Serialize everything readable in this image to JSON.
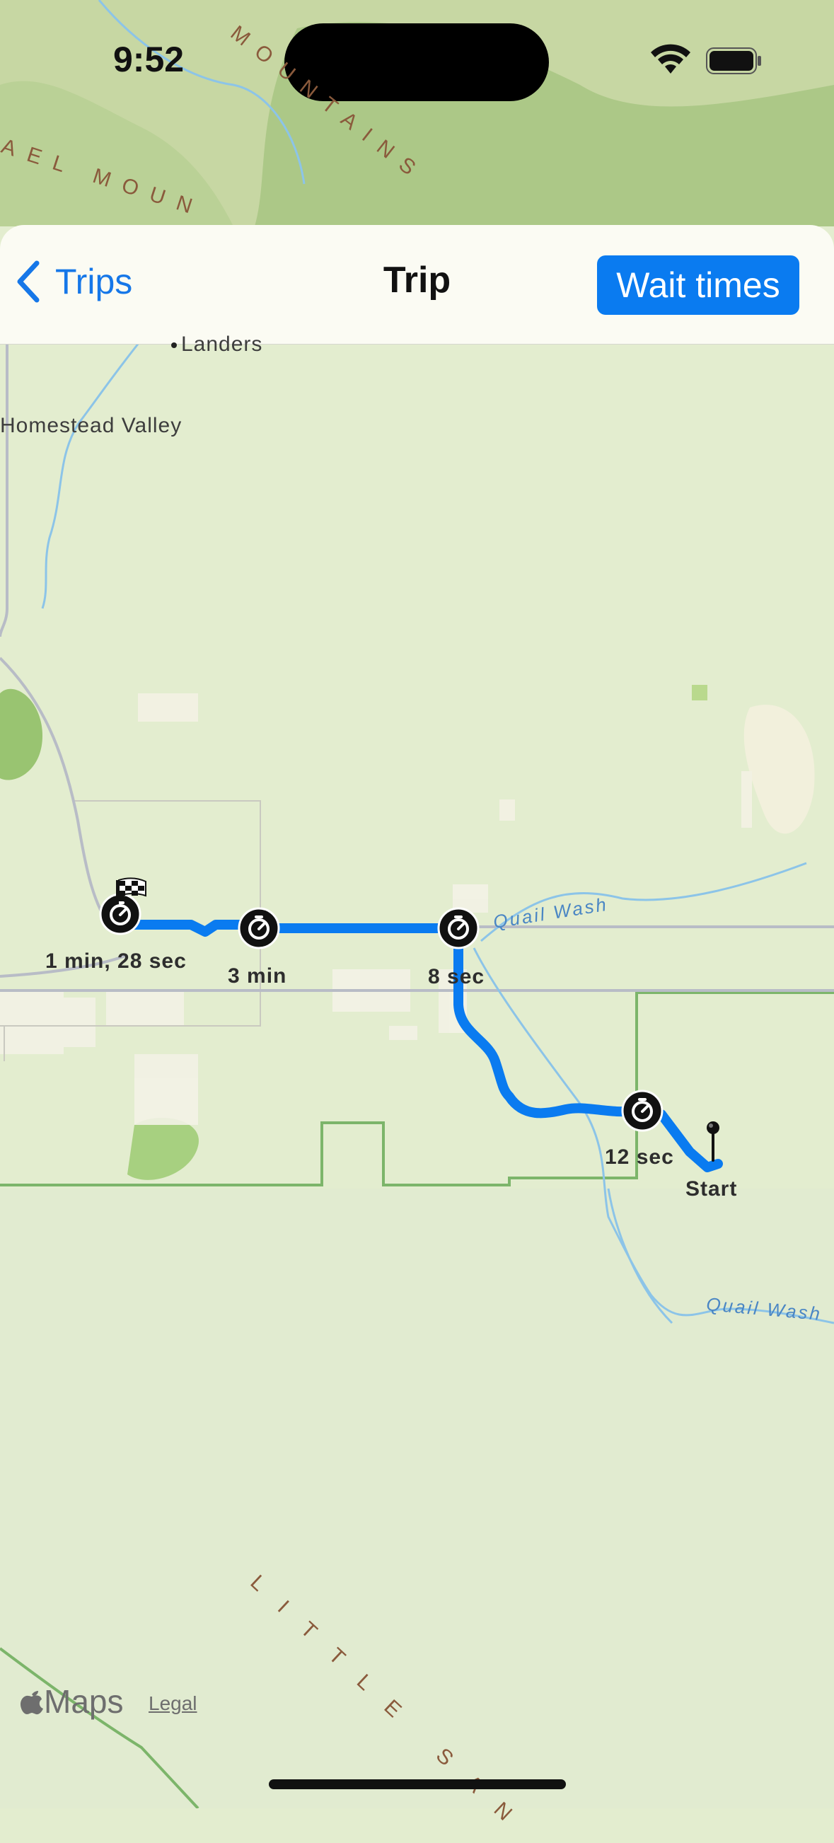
{
  "status_bar": {
    "time": "9:52"
  },
  "nav": {
    "back_label": "Trips",
    "title": "Trip",
    "action_label": "Wait times"
  },
  "map": {
    "places": {
      "landers": "Landers",
      "homestead_valley": "Homestead Valley",
      "mountains_top": "MOUNTAINS",
      "mountains_left": "AEL MOUN",
      "little_san": "LITTLE SAN",
      "quail_wash_1": "Quail Wash",
      "quail_wash_2": "Quail Wash"
    },
    "stops": [
      {
        "label": "1 min, 28 sec"
      },
      {
        "label": "3 min"
      },
      {
        "label": "8 sec"
      },
      {
        "label": "12 sec"
      }
    ],
    "start_label": "Start",
    "attribution": "Maps",
    "legal": "Legal",
    "route_color": "#0a7bf0",
    "marker_icon": "timer-icon",
    "finish_icon": "checkered-flag-icon",
    "start_icon": "pin-icon"
  }
}
